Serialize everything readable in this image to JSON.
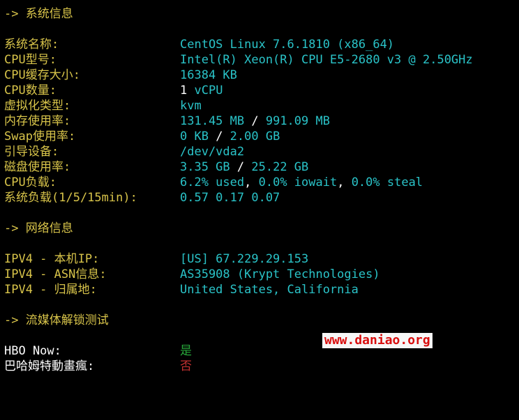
{
  "sections": {
    "system_header": "-> 系统信息",
    "network_header": "-> 网络信息",
    "media_header": "-> 流媒体解锁测试"
  },
  "system": [
    {
      "label": "系统名称:",
      "value": "CentOS Linux 7.6.1810 (x86_64)"
    },
    {
      "label": "CPU型号:",
      "value": "Intel(R) Xeon(R) CPU E5-2680 v3 @ 2.50GHz"
    },
    {
      "label": "CPU缓存大小:",
      "value": "16384 KB"
    },
    {
      "label": "CPU数量:",
      "value_num": "1",
      "value_unit": " vCPU"
    },
    {
      "label": "虚拟化类型:",
      "value": "kvm"
    },
    {
      "label": "内存使用率:",
      "used": "131.45 MB",
      "sep": " / ",
      "total": "991.09 MB"
    },
    {
      "label": "Swap使用率:",
      "used": "0 KB",
      "sep": " / ",
      "total": "2.00 GB"
    },
    {
      "label": "引导设备:",
      "value": "/dev/vda2"
    },
    {
      "label": "磁盘使用率:",
      "used": "3.35 GB",
      "sep": " / ",
      "total": "25.22 GB"
    },
    {
      "label": "CPU负载:",
      "p1": "6.2% used",
      "c1": ",",
      "p2": " 0.0% iowait",
      "c2": ",",
      "p3": " 0.0% steal"
    },
    {
      "label": "系统负载(1/5/15min):",
      "value": "0.57 0.17 0.07"
    }
  ],
  "network": [
    {
      "label": "IPV4 - 本机IP:",
      "value": "[US] 67.229.29.153"
    },
    {
      "label": "IPV4 - ASN信息:",
      "value": "AS35908 (Krypt Technologies)"
    },
    {
      "label": "IPV4 - 归属地:",
      "value": "United States, California"
    }
  ],
  "media": [
    {
      "label": "HBO Now:",
      "value": "是"
    },
    {
      "label": "巴哈姆特動畫瘋:",
      "value": "否"
    }
  ],
  "watermark": "www.daniao.org",
  "colors": {
    "background": "#000000",
    "label": "#d8c44a",
    "value": "#2ac3c8",
    "white": "#ffffff",
    "ok": "#27a83a",
    "no": "#c23030",
    "watermark": "#e01010"
  }
}
